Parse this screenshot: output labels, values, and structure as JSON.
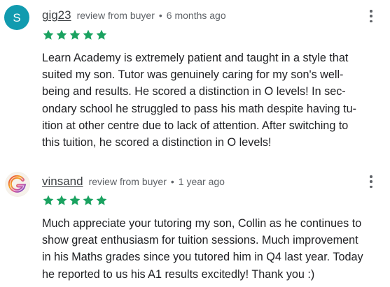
{
  "reviews": [
    {
      "avatar_letter": "S",
      "avatar_color": "#119baf",
      "username": "gig23",
      "reviewer_type": "review from buyer",
      "time_ago": "6 months ago",
      "rating": 5,
      "star_color": "#1aa260",
      "text_lines": [
        "Learn Academy is extremely patient and taught in a style that",
        "suited my son. Tutor was genuinely caring for my son's well-",
        "being and results. He scored a distinction in O levels! In sec-",
        "ondary school he struggled to pass his math despite having tu-",
        "ition at other centre due to lack of attention. After switching to",
        "this tuition, he scored a distinction in O levels!"
      ]
    },
    {
      "avatar_icon": "gradient-g-logo-icon",
      "username": "vinsand",
      "reviewer_type": "review from buyer",
      "time_ago": "1 year ago",
      "rating": 5,
      "star_color": "#1aa260",
      "text_lines": [
        "Much appreciate your tutoring my son, Collin as he continues to",
        "show great enthusiasm for tuition sessions. Much improvement",
        "in his Maths grades since you tutored him in Q4 last year. Today",
        "he reported to us his A1 results excitedly! Thank you :)"
      ]
    }
  ]
}
